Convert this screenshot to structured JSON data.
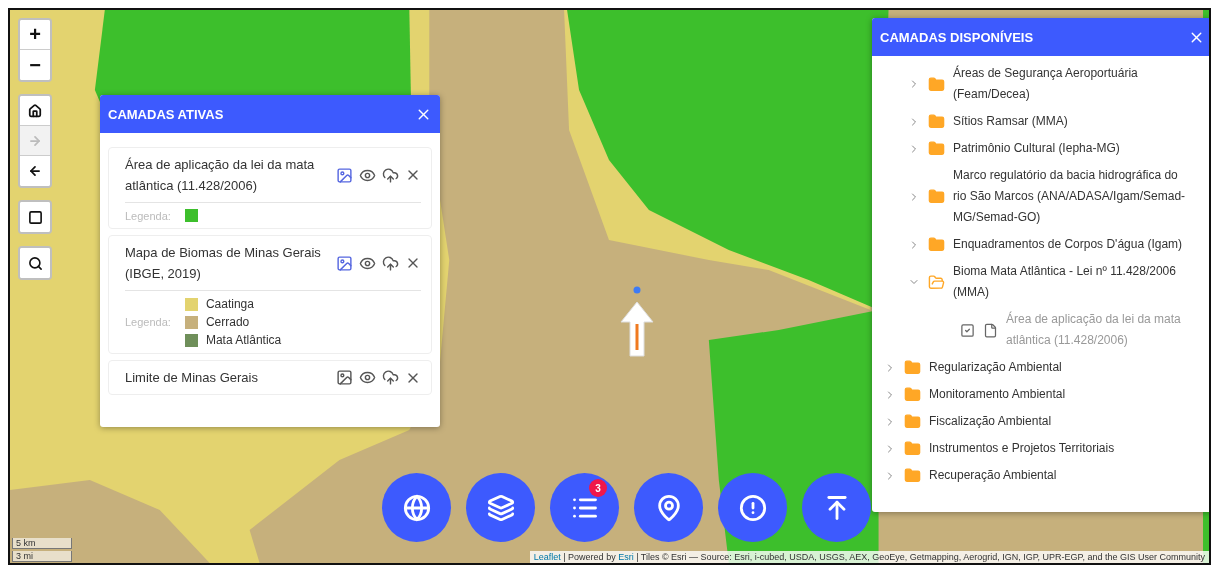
{
  "map_controls": {
    "zoom": [
      "+",
      "−"
    ],
    "history": [
      {
        "kind": "home",
        "disabled": false
      },
      {
        "kind": "forward",
        "disabled": true
      },
      {
        "kind": "back",
        "disabled": false
      }
    ],
    "tools": [
      {
        "kind": "frame"
      },
      {
        "kind": "search"
      }
    ]
  },
  "active_layers": {
    "title": "CAMADAS ATIVAS",
    "layers": [
      {
        "name": "Área de aplicação da lei da mata atlântica (11.428/2006)",
        "legend_on": true,
        "legend_label": "Legenda:",
        "legend": [
          {
            "color": "#3dbf2c"
          }
        ]
      },
      {
        "name": "Mapa de Biomas de Minas Gerais (IBGE, 2019)",
        "legend_on": true,
        "legend_label": "Legenda:",
        "legend": [
          {
            "color": "#e3d36f",
            "label": "Caatinga"
          },
          {
            "color": "#c6b07c",
            "label": "Cerrado"
          },
          {
            "color": "#6f8f5a",
            "label": "Mata Atlântica"
          }
        ]
      },
      {
        "name": "Limite de Minas Gerais",
        "legend_on": false
      }
    ]
  },
  "available_layers": {
    "title": "CAMADAS DISPONÍVEIS",
    "tree": [
      {
        "children": [
          {
            "label": "Áreas de Segurança Aeroportuária (Feam/Decea)",
            "expanded": false
          },
          {
            "label": "Sítios Ramsar (MMA)",
            "expanded": false
          },
          {
            "label": "Patrimônio Cultural (Iepha-MG)",
            "expanded": false
          },
          {
            "label": "Marco regulatório da bacia hidrográfica do rio São Marcos (ANA/ADASA/Igam/Semad-MG/Semad-GO)",
            "expanded": false
          },
          {
            "label": "Enquadramentos de Corpos D'água (Igam)",
            "expanded": false
          },
          {
            "label": "Bioma Mata Atlântica - Lei nº 11.428/2006 (MMA)",
            "expanded": true,
            "children": [
              {
                "kind": "layer",
                "label": "Área de aplicação da lei da mata atlântica (11.428/2006)",
                "checked": true,
                "disabled": true
              }
            ]
          }
        ]
      },
      {
        "label": "Regularização Ambiental",
        "expanded": false
      },
      {
        "label": "Monitoramento Ambiental",
        "expanded": false
      },
      {
        "label": "Fiscalização Ambiental",
        "expanded": false
      },
      {
        "label": "Instrumentos e Projetos Territoriais",
        "expanded": false
      },
      {
        "label": "Recuperação Ambiental",
        "expanded": false
      }
    ]
  },
  "action_buttons": [
    {
      "kind": "globe"
    },
    {
      "kind": "layers"
    },
    {
      "kind": "list",
      "badge": "3"
    },
    {
      "kind": "pin"
    },
    {
      "kind": "alert"
    },
    {
      "kind": "upload"
    }
  ],
  "scale": [
    "5 km",
    "3 mi"
  ],
  "attribution": [
    {
      "kind": "link",
      "text": "Leaflet"
    },
    {
      "kind": "text",
      "text": " | Powered by "
    },
    {
      "kind": "link",
      "text": "Esri"
    },
    {
      "kind": "text",
      "text": " | Tiles © Esri — Source: Esri, i-cubed, USDA, USGS, AEX, GeoEye, Getmapping, Aerogrid, IGN, IGP, UPR-EGP, and the GIS User Community"
    }
  ]
}
